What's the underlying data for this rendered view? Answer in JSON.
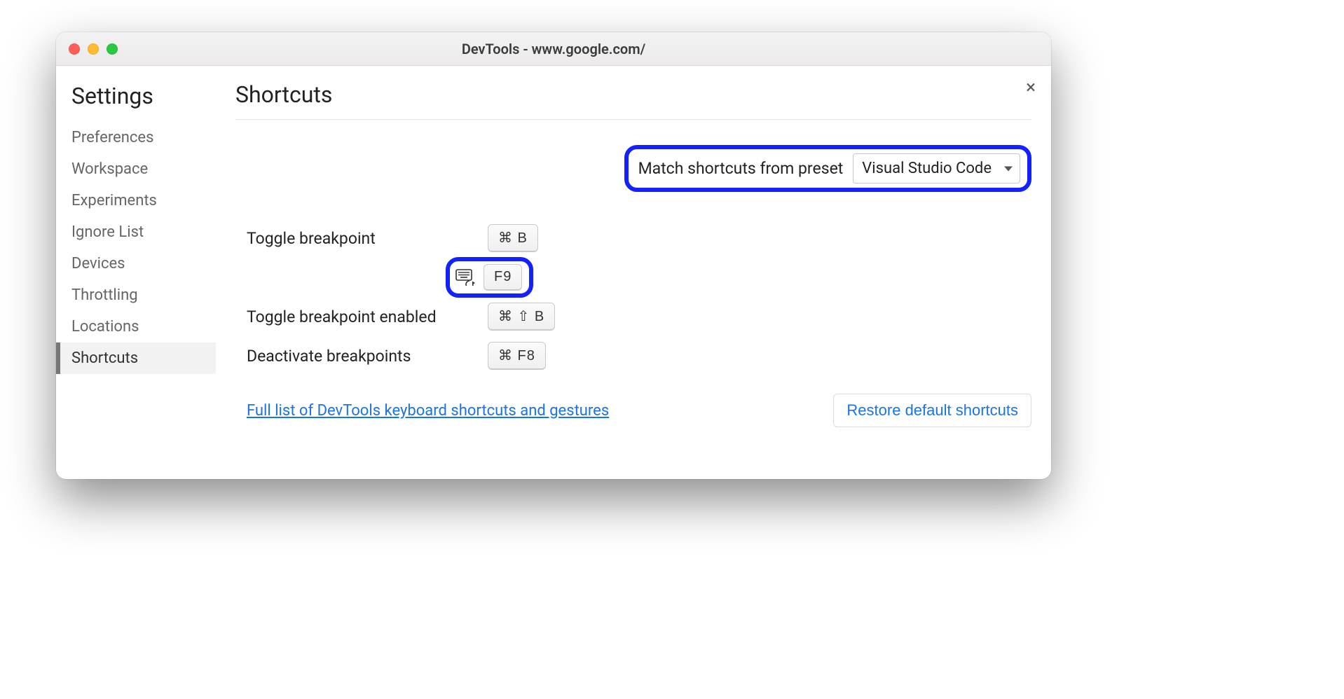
{
  "window": {
    "title": "DevTools - www.google.com/"
  },
  "sidebar": {
    "title": "Settings",
    "items": [
      {
        "label": "Preferences"
      },
      {
        "label": "Workspace"
      },
      {
        "label": "Experiments"
      },
      {
        "label": "Ignore List"
      },
      {
        "label": "Devices"
      },
      {
        "label": "Throttling"
      },
      {
        "label": "Locations"
      },
      {
        "label": "Shortcuts"
      }
    ],
    "active_index": 7
  },
  "main": {
    "title": "Shortcuts",
    "preset_label": "Match shortcuts from preset",
    "preset_value": "Visual Studio Code",
    "shortcuts": [
      {
        "label": "Toggle breakpoint",
        "keys": "⌘ B"
      },
      {
        "label": "",
        "keys": "F9",
        "has_keyboard_icon": true,
        "highlighted": true
      },
      {
        "label": "Toggle breakpoint enabled",
        "keys": "⌘ ⇧ B"
      },
      {
        "label": "Deactivate breakpoints",
        "keys": "⌘ F8"
      }
    ],
    "docs_link": "Full list of DevTools keyboard shortcuts and gestures",
    "restore_button": "Restore default shortcuts"
  },
  "highlight_color": "#1321ff"
}
